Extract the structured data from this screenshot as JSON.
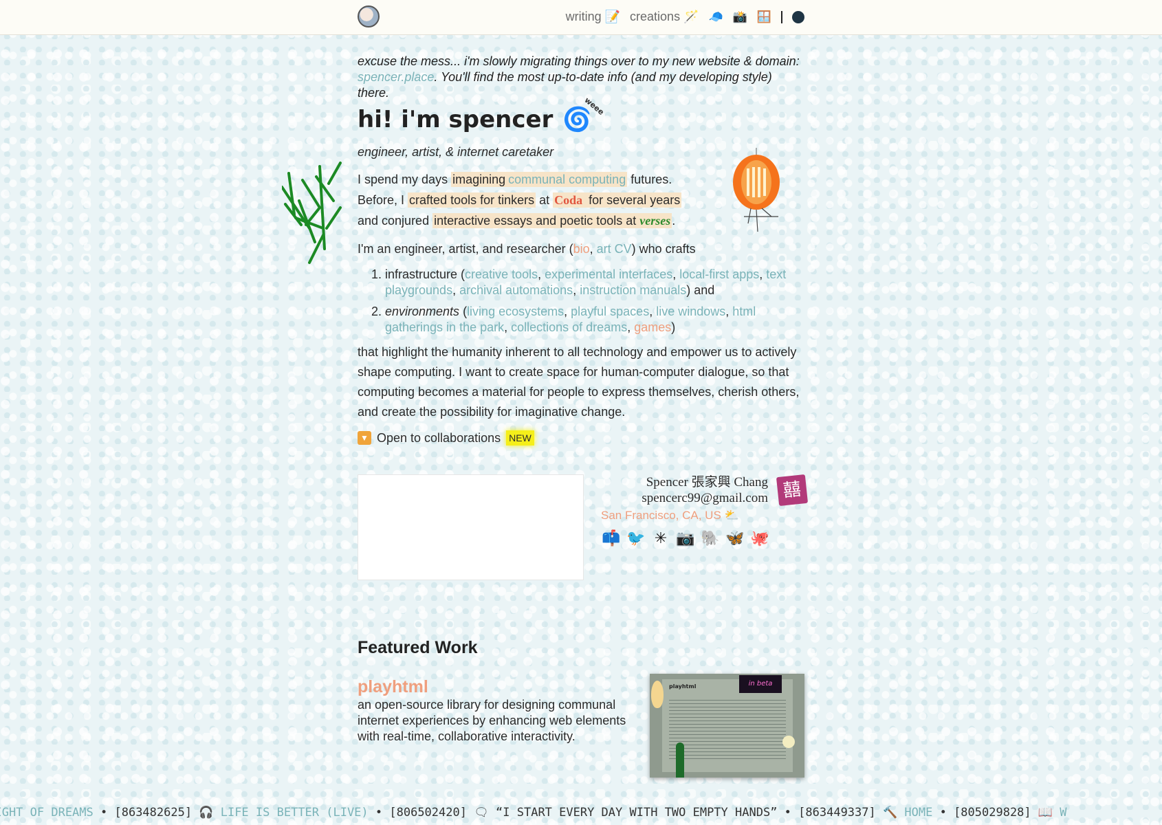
{
  "nav": {
    "writing": "writing 📝",
    "creations": "creations 🪄",
    "icons": [
      "🧢",
      "📸",
      "🪟"
    ]
  },
  "notice": {
    "before": "excuse the mess... i'm slowly migrating things over to my new website & domain: ",
    "link": "spencer.place",
    "after": ". You'll find the most up-to-date info (and my developing style) there."
  },
  "hero": {
    "title": "hi! i'm spencer",
    "swirl": "🌀",
    "weee": "weee",
    "tagline": "engineer, artist, & internet caretaker"
  },
  "intro": {
    "t1": "I spend my days ",
    "imagining": "imagining",
    "communal": "communal computing",
    "futures": " futures.",
    "t2": "Before, I ",
    "crafted": "crafted tools for tinkers",
    "at1": " at ",
    "coda": "Coda",
    "several": " for several years",
    "t3": "and conjured ",
    "essays": "interactive essays and poetic tools at",
    "verses": "verses",
    "period": "."
  },
  "about": {
    "t1": "I'm an engineer, artist, and researcher (",
    "bio": "bio",
    "comma": ", ",
    "artcv": "art CV",
    "t2": ") who crafts"
  },
  "list": {
    "infra_label": "infrastructure (",
    "infra_links": [
      "creative tools",
      "experimental interfaces",
      "local-first apps",
      "text playgrounds",
      "archival automations",
      "instruction manuals"
    ],
    "infra_end": ") and",
    "env_label": "environments",
    "env_links": [
      "living ecosystems",
      "playful spaces",
      "live windows",
      "html gatherings in the park",
      "collections of dreams",
      "games"
    ],
    "env_end": ")"
  },
  "mission": "that highlight the humanity inherent to all technology and empower us to actively shape computing. I want to create space for human-computer dialogue, so that computing becomes a material for people to express themselves, cherish others, and create the possibility for imaginative change.",
  "collab": {
    "label": "Open to collaborations",
    "badge": "NEW"
  },
  "card": {
    "name": "Spencer 張家興 Chang",
    "email": "spencerc99@gmail.com",
    "location": "San Francisco, CA, US ⛅",
    "stamp": "囍",
    "socials": [
      "📫",
      "🐦",
      "✳",
      "📷",
      "🐘",
      "🦋",
      "🐙"
    ]
  },
  "featured": {
    "heading": "Featured Work",
    "project_title": "playhtml",
    "project_desc": "an open-source library for designing communal internet experiences by enhancing web elements with real-time, collaborative interactivity.",
    "thumb_title": "playhtml",
    "thumb_badge": "in beta"
  },
  "ticker": [
    {
      "label": "WEIGHT OF DREAMS",
      "sep": " • ",
      "id": "[863482625]",
      "icon": " 🎧 "
    },
    {
      "label": "LIFE IS BETTER (LIVE)",
      "sep": " • ",
      "id": "[806502420]",
      "icon": " 🗨 "
    },
    {
      "quote": "“I START EVERY DAY WITH TWO EMPTY HANDS”",
      "sep": " • ",
      "id": "[863449337]",
      "icon": " 🔨 "
    },
    {
      "label": "HOME",
      "sep": " • ",
      "id": "[805029828]",
      "icon": " 📖 ",
      "tail": "W"
    }
  ],
  "colors": {
    "link": "#7ab3b8",
    "link_alt": "#ef9f7e",
    "highlight": "#f7e4c8",
    "coda": "#e1563f",
    "verses": "#2e8b2e",
    "badge": "#f5ef1a"
  }
}
